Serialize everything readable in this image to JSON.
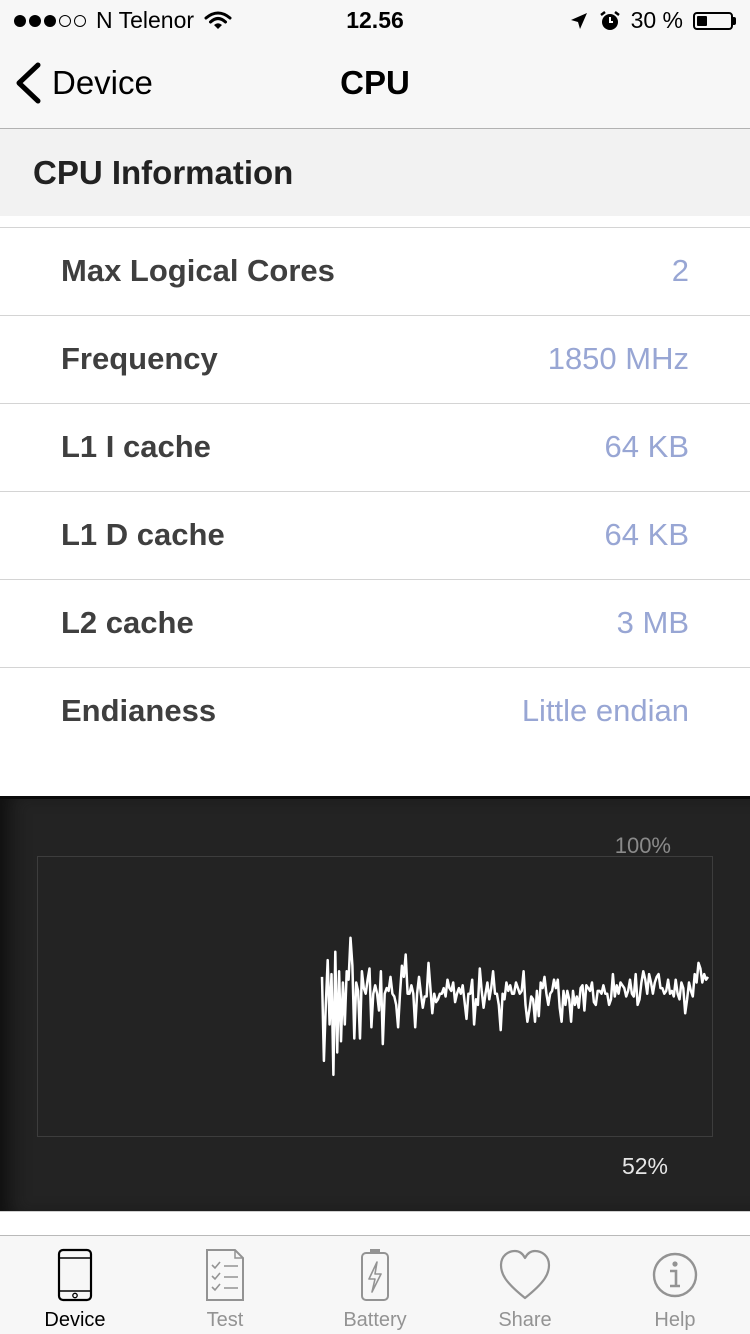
{
  "status_bar": {
    "carrier": "N Telenor",
    "time": "12.56",
    "battery_percent": "30 %",
    "signal_bars": 3,
    "signal_total": 5,
    "battery_level": 0.3
  },
  "nav": {
    "back_label": "Device",
    "title": "CPU"
  },
  "section": {
    "title": "CPU Information"
  },
  "info_rows": [
    {
      "label": "Max Logical Cores",
      "value": "2"
    },
    {
      "label": "Frequency",
      "value": "1850 MHz"
    },
    {
      "label": "L1 I cache",
      "value": "64 KB"
    },
    {
      "label": "L1 D cache",
      "value": "64 KB"
    },
    {
      "label": "L2 cache",
      "value": "3 MB"
    },
    {
      "label": "Endianess",
      "value": "Little endian"
    }
  ],
  "graph": {
    "max_label": "100%",
    "current_label": "52%",
    "ylim": [
      0,
      100
    ],
    "usage_series": [
      57,
      27,
      47,
      63,
      40,
      58,
      22,
      66,
      30,
      59,
      34,
      55,
      40,
      59,
      56,
      71,
      61,
      35,
      55,
      52,
      35,
      59,
      53,
      51,
      56,
      60,
      39,
      51,
      54,
      51,
      45,
      59,
      33,
      51,
      53,
      52,
      57,
      51,
      50,
      47,
      39,
      51,
      61,
      57,
      65,
      51,
      51,
      54,
      51,
      39,
      51,
      57,
      51,
      46,
      50,
      50,
      62,
      53,
      44,
      51,
      48,
      49,
      51,
      51,
      53,
      50,
      56,
      53,
      52,
      55,
      48,
      51,
      53,
      51,
      54,
      48,
      42,
      51,
      51,
      56,
      40,
      49,
      47,
      60,
      52,
      46,
      51,
      55,
      49,
      53,
      59,
      51,
      51,
      47,
      38,
      51,
      49,
      55,
      52,
      54,
      51,
      51,
      55,
      53,
      51,
      52,
      59,
      47,
      41,
      45,
      50,
      49,
      41,
      52,
      43,
      55,
      53,
      57,
      51,
      47,
      51,
      52,
      56,
      53,
      56,
      46,
      41,
      52,
      47,
      52,
      49,
      41,
      52,
      47,
      50,
      46,
      53,
      54,
      45,
      54,
      53,
      52,
      55,
      48,
      47,
      52,
      52,
      51,
      54,
      51,
      51,
      47,
      49,
      58,
      50,
      54,
      51,
      55,
      54,
      53,
      50,
      52,
      56,
      51,
      50,
      58,
      47,
      49,
      55,
      59,
      56,
      51,
      58,
      55,
      51,
      55,
      57,
      58,
      53,
      53,
      51,
      52,
      56,
      51,
      52,
      50,
      56,
      51,
      49,
      55,
      53,
      44,
      49,
      55,
      52,
      50,
      58,
      55,
      62,
      60,
      55,
      58,
      56,
      57
    ]
  },
  "tabs": [
    {
      "label": "Device",
      "icon": "phone-icon",
      "active": true
    },
    {
      "label": "Test",
      "icon": "checklist-icon",
      "active": false
    },
    {
      "label": "Battery",
      "icon": "battery-icon",
      "active": false
    },
    {
      "label": "Share",
      "icon": "heart-icon",
      "active": false
    },
    {
      "label": "Help",
      "icon": "info-icon",
      "active": false
    }
  ],
  "colors": {
    "value_text": "#98a6d4",
    "graph_bg": "#232323",
    "graph_line": "#ffffff",
    "tab_active": "#000000",
    "tab_inactive": "#939393"
  }
}
